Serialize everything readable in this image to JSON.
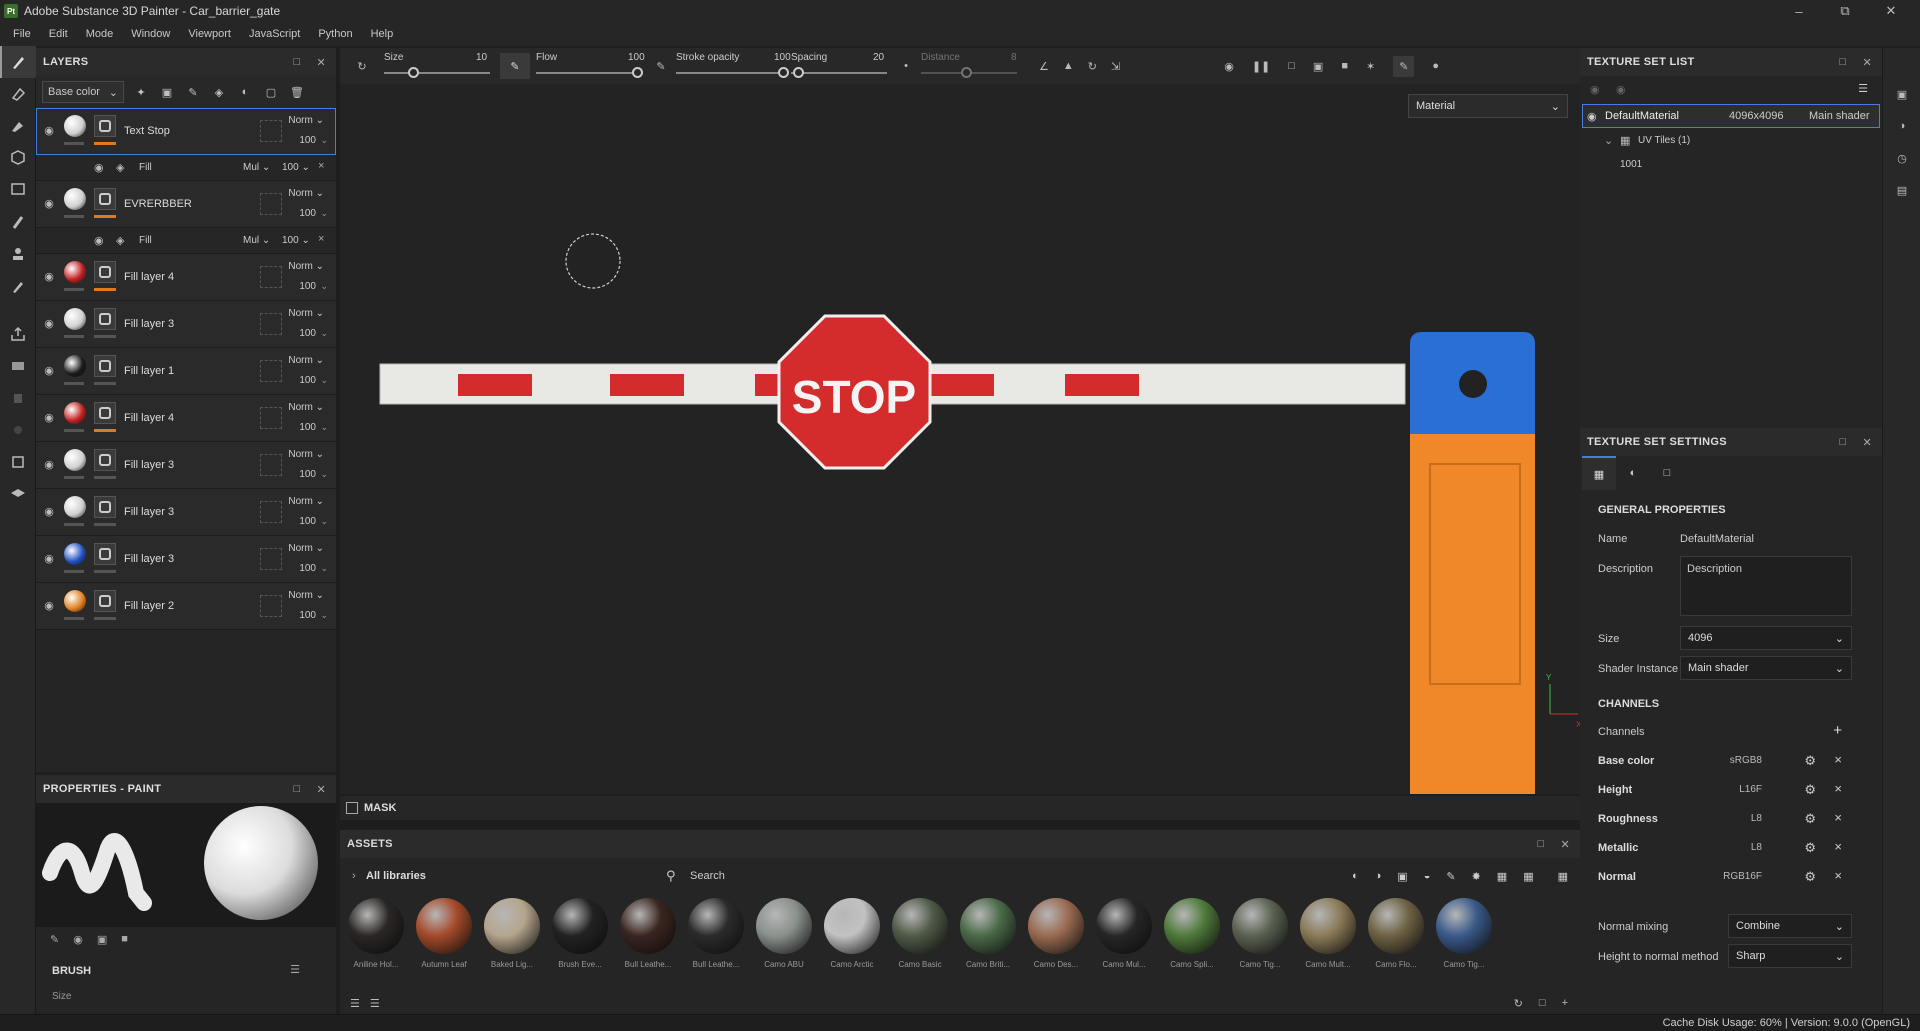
{
  "app": {
    "title": "Adobe Substance 3D Painter - Car_barrier_gate",
    "logo": "Pt"
  },
  "menu": [
    "File",
    "Edit",
    "Mode",
    "Window",
    "Viewport",
    "JavaScript",
    "Python",
    "Help"
  ],
  "layers_panel": {
    "title": "LAYERS",
    "channel_select": "Base color",
    "layers": [
      {
        "name": "Text Stop",
        "blend": "Norm",
        "opacity": "100",
        "ball": "#cfcfcf",
        "under": "#e07a20",
        "sub": {
          "name": "Fill",
          "mode": "Mul",
          "value": "100"
        }
      },
      {
        "name": "EVRERBBER",
        "blend": "Norm",
        "opacity": "100",
        "ball": "#cfcfcf",
        "under": "#e07a20",
        "sub": {
          "name": "Fill",
          "mode": "Mul",
          "value": "100"
        }
      },
      {
        "name": "Fill layer 4",
        "blend": "Norm",
        "opacity": "100",
        "ball": "#c02020",
        "under": "#e07a20"
      },
      {
        "name": "Fill layer 3",
        "blend": "Norm",
        "opacity": "100",
        "ball": "#d0d0d0",
        "under": "#555555"
      },
      {
        "name": "Fill layer 1",
        "blend": "Norm",
        "opacity": "100",
        "ball": "#1a1a1a",
        "under": "#555555"
      },
      {
        "name": "Fill layer 4",
        "blend": "Norm",
        "opacity": "100",
        "ball": "#c02020",
        "under": "#e07a20"
      },
      {
        "name": "Fill layer 3",
        "blend": "Norm",
        "opacity": "100",
        "ball": "#d0d0d0",
        "under": "#555555"
      },
      {
        "name": "Fill layer 3",
        "blend": "Norm",
        "opacity": "100",
        "ball": "#d0d0d0",
        "under": "#555555"
      },
      {
        "name": "Fill layer 3",
        "blend": "Norm",
        "opacity": "100",
        "ball": "#2050c0",
        "under": "#555555"
      },
      {
        "name": "Fill layer 2",
        "blend": "Norm",
        "opacity": "100",
        "ball": "#e08020",
        "under": "#555555"
      }
    ]
  },
  "properties_panel": {
    "title": "PROPERTIES - PAINT",
    "brush_title": "BRUSH",
    "size_label": "Size"
  },
  "toolbar": {
    "size_label": "Size",
    "size_value": "10",
    "flow_label": "Flow",
    "flow_value": "100",
    "stroke_label": "Stroke opacity",
    "stroke_value": "100",
    "spacing_label": "Spacing",
    "spacing_value": "20",
    "distance_label": "Distance",
    "distance_value": "8"
  },
  "viewport": {
    "material_select": "Material",
    "stop_text": "STOP",
    "axis_y": "Y",
    "axis_x": "X"
  },
  "mask": {
    "label": "MASK"
  },
  "assets": {
    "title": "ASSETS",
    "library": "All libraries",
    "search_placeholder": "Search",
    "items": [
      {
        "label": "Aniline Hol...",
        "color": "#2a2624"
      },
      {
        "label": "Autumn Leaf",
        "color": "#a44a2a"
      },
      {
        "label": "Baked Lig...",
        "color": "#b5a58c"
      },
      {
        "label": "Brush Eve...",
        "color": "#222222"
      },
      {
        "label": "Bull Leathe...",
        "color": "#3a2520"
      },
      {
        "label": "Bull Leathe...",
        "color": "#2b2b2b"
      },
      {
        "label": "Camo ABU",
        "color": "#8a918c"
      },
      {
        "label": "Camo Arctic",
        "color": "#c2c2c2"
      },
      {
        "label": "Camo Basic",
        "color": "#4f5a48"
      },
      {
        "label": "Camo Briti...",
        "color": "#4a6a48"
      },
      {
        "label": "Camo Des...",
        "color": "#9a6a52"
      },
      {
        "label": "Camo Mul...",
        "color": "#262626"
      },
      {
        "label": "Camo Spli...",
        "color": "#4e7a3a"
      },
      {
        "label": "Camo Tig...",
        "color": "#5a6252"
      },
      {
        "label": "Camo Mult...",
        "color": "#8a7a58"
      },
      {
        "label": "Camo Flo...",
        "color": "#6e6244"
      },
      {
        "label": "Camo Tig...",
        "color": "#3a5a8a"
      }
    ]
  },
  "texture_set_list": {
    "title": "TEXTURE SET LIST",
    "material": "DefaultMaterial",
    "resolution": "4096x4096",
    "shader": "Main shader",
    "uv_tiles": "UV Tiles (1)",
    "tile": "1001"
  },
  "texture_set_settings": {
    "title": "TEXTURE SET SETTINGS",
    "general_title": "GENERAL PROPERTIES",
    "name_label": "Name",
    "name_value": "DefaultMaterial",
    "desc_label": "Description",
    "desc_placeholder": "Description",
    "size_label": "Size",
    "size_value": "4096",
    "shader_label": "Shader Instance",
    "shader_value": "Main shader",
    "channels_title": "CHANNELS",
    "channels_label": "Channels",
    "channels": [
      {
        "name": "Base color",
        "format": "sRGB8"
      },
      {
        "name": "Height",
        "format": "L16F"
      },
      {
        "name": "Roughness",
        "format": "L8"
      },
      {
        "name": "Metallic",
        "format": "L8"
      },
      {
        "name": "Normal",
        "format": "RGB16F"
      }
    ],
    "normal_mixing_label": "Normal mixing",
    "normal_mixing_value": "Combine",
    "h2n_label": "Height to normal method",
    "h2n_value": "Sharp"
  },
  "status": {
    "text": "Cache Disk Usage:   60% | Version: 9.0.0 (OpenGL)"
  },
  "colors": {
    "accent": "#4a7be0",
    "orange": "#e07a20"
  }
}
